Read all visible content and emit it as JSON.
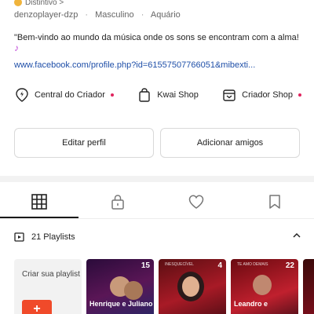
{
  "profile": {
    "badge_label": "Distintivo >",
    "username": "denzoplayer-dzp",
    "gender": "Masculino",
    "sign": "Aquário",
    "bio": "\"Bem-vindo ao mundo da música onde os sons se encontram com a alma!",
    "link": "www.facebook.com/profile.php?id=61557507766051&mibexti..."
  },
  "services": [
    {
      "label": "Central do Criador",
      "icon": "lightning-pin-icon",
      "has_dot": true
    },
    {
      "label": "Kwai Shop",
      "icon": "shopping-bag-icon",
      "has_dot": false
    },
    {
      "label": "Criador Shop",
      "icon": "shop-badge-icon",
      "has_dot": true
    }
  ],
  "buttons": {
    "edit": "Editar perfil",
    "add_friends": "Adicionar amigos"
  },
  "tabs": [
    {
      "icon": "grid-icon",
      "active": true
    },
    {
      "icon": "lock-icon",
      "active": false
    },
    {
      "icon": "heart-icon",
      "active": false
    },
    {
      "icon": "bookmark-icon",
      "active": false
    }
  ],
  "playlists": {
    "title": "21 Playlists",
    "create_label": "Criar sua playlist",
    "create_button": "+",
    "items": [
      {
        "count": "15",
        "caption": "Henrique e Juliano",
        "tag": ""
      },
      {
        "count": "4",
        "caption": "",
        "tag": "INESQUECÍVEL"
      },
      {
        "count": "22",
        "caption": "Leandro e",
        "tag": "TE AMO DEMAIS"
      }
    ]
  },
  "colors": {
    "accent": "#f04a2a",
    "link": "#1f4fa8",
    "dot": "#e0245e"
  }
}
